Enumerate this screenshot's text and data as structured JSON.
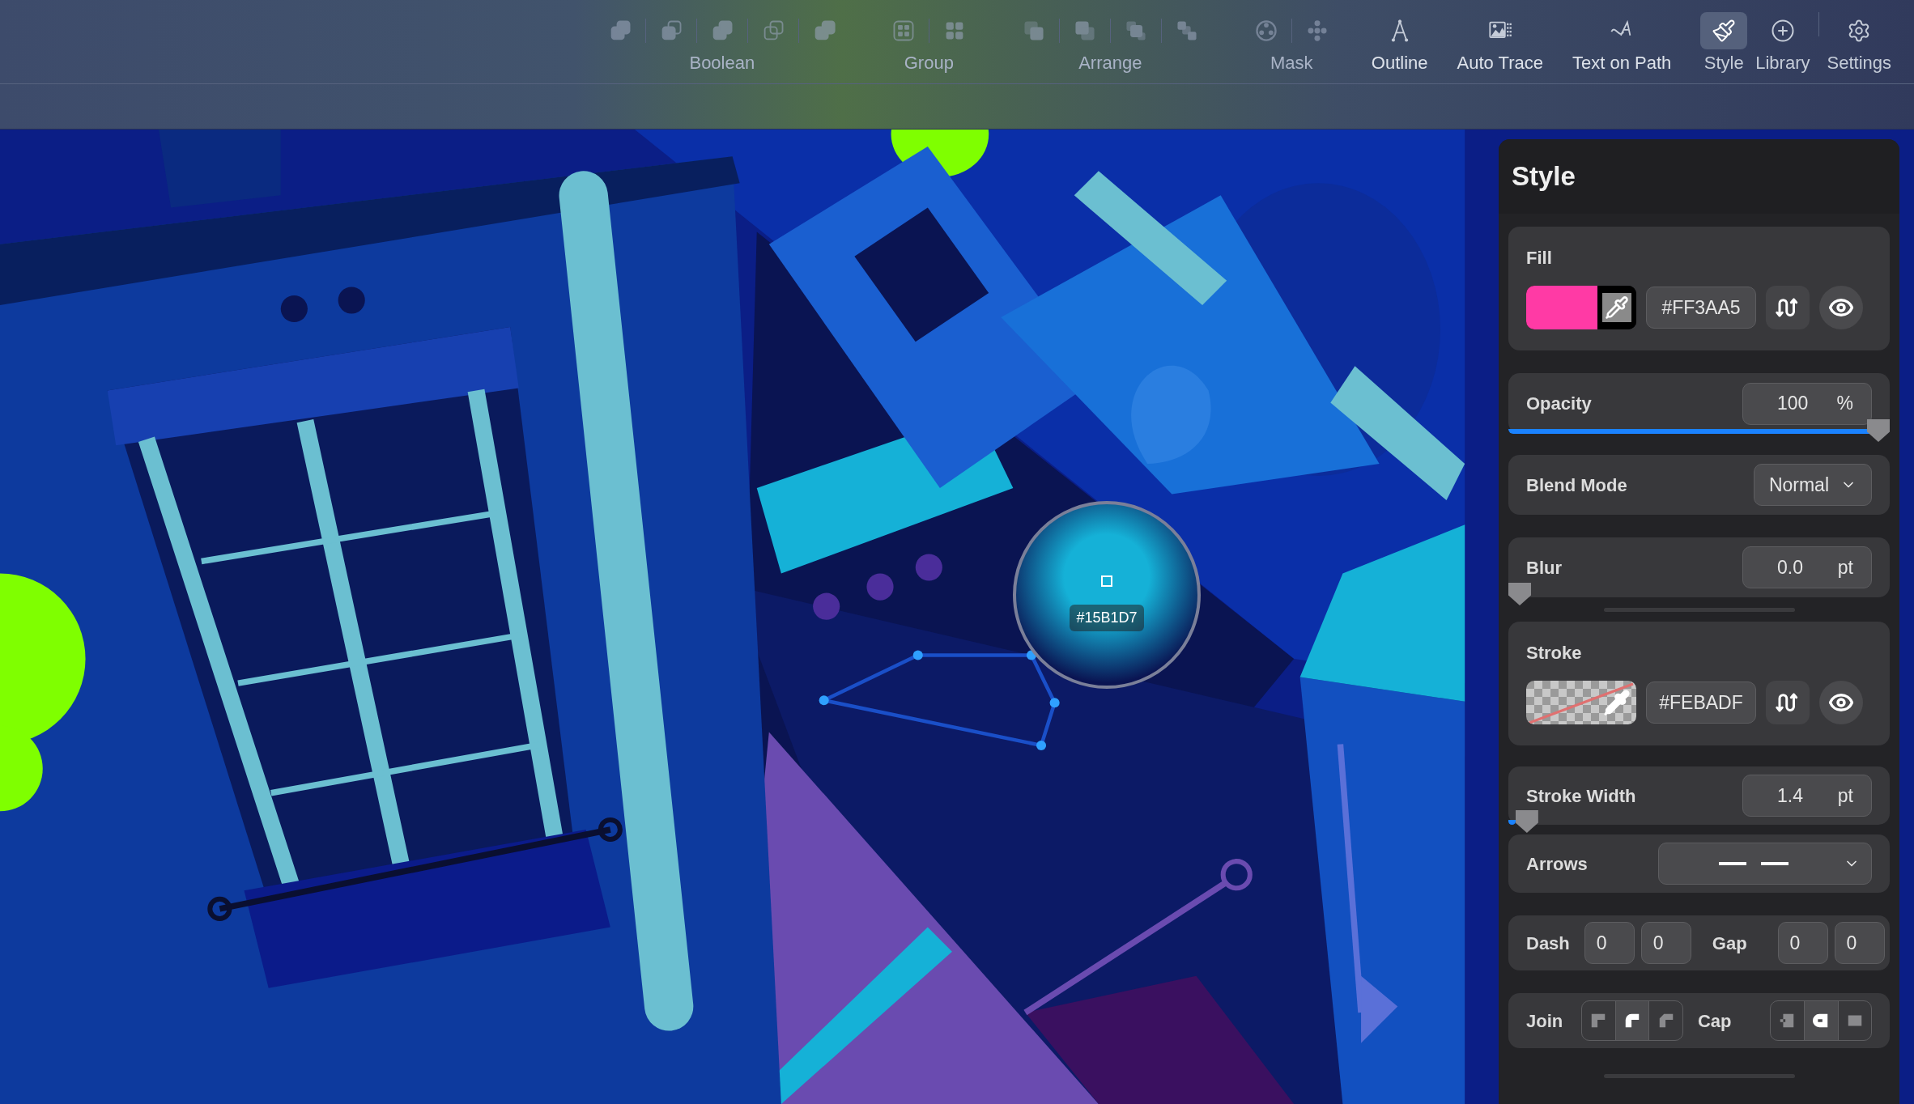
{
  "toolbar": {
    "groups": [
      {
        "label": "Boolean",
        "disabled": true,
        "tools": [
          {
            "kind": "union"
          },
          {
            "kind": "subtract"
          },
          {
            "kind": "intersect"
          },
          {
            "kind": "exclude"
          },
          {
            "kind": "divide"
          }
        ]
      },
      {
        "label": "Group",
        "disabled": true,
        "tools": [
          {
            "kind": "group"
          },
          {
            "kind": "ungroup"
          }
        ]
      },
      {
        "label": "Arrange",
        "disabled": true,
        "tools": [
          {
            "kind": "front"
          },
          {
            "kind": "forward"
          },
          {
            "kind": "backward"
          },
          {
            "kind": "back"
          }
        ]
      },
      {
        "label": "Mask",
        "disabled": true,
        "tools": [
          {
            "kind": "mask"
          },
          {
            "kind": "unmask"
          }
        ]
      },
      {
        "label": "Outline",
        "disabled": false,
        "tools": [
          {
            "kind": "outline"
          }
        ]
      },
      {
        "label": "Auto Trace",
        "disabled": false,
        "tools": [
          {
            "kind": "trace"
          }
        ]
      },
      {
        "label": "Text on Path",
        "disabled": false,
        "tools": [
          {
            "kind": "textpath"
          }
        ]
      }
    ],
    "panels": [
      {
        "label": "Style",
        "kind": "style",
        "selected": true
      },
      {
        "label": "Library",
        "kind": "library",
        "selected": false
      },
      {
        "label": "Settings",
        "kind": "settings",
        "selected": false
      }
    ]
  },
  "loupe": {
    "hex": "#15B1D7"
  },
  "style_panel": {
    "title": "Style",
    "fill": {
      "label": "Fill",
      "hex": "#FF3AA5",
      "transparent": false,
      "visible": true
    },
    "opacity": {
      "label": "Opacity",
      "value": "100",
      "unit": "%",
      "level": 1
    },
    "blend_mode": {
      "label": "Blend Mode",
      "value": "Normal"
    },
    "blur": {
      "label": "Blur",
      "value": "0.0",
      "unit": "pt",
      "level": 0
    },
    "stroke": {
      "label": "Stroke",
      "hex": "#FEBADF",
      "transparent": true,
      "visible": true
    },
    "stroke_width": {
      "label": "Stroke Width",
      "value": "1.4",
      "unit": "pt",
      "level": 0.02
    },
    "arrows": {
      "label": "Arrows"
    },
    "dash": {
      "label": "Dash",
      "values": [
        "0",
        "0"
      ]
    },
    "gap": {
      "label": "Gap",
      "values": [
        "0",
        "0"
      ]
    },
    "join": {
      "label": "Join",
      "options": [
        {
          "kind": "miter",
          "selected": false
        },
        {
          "kind": "round",
          "selected": true
        },
        {
          "kind": "bevel",
          "selected": false
        }
      ]
    },
    "cap": {
      "label": "Cap",
      "options": [
        {
          "kind": "butt",
          "selected": false
        },
        {
          "kind": "round",
          "selected": true
        },
        {
          "kind": "square",
          "selected": false
        }
      ]
    }
  }
}
